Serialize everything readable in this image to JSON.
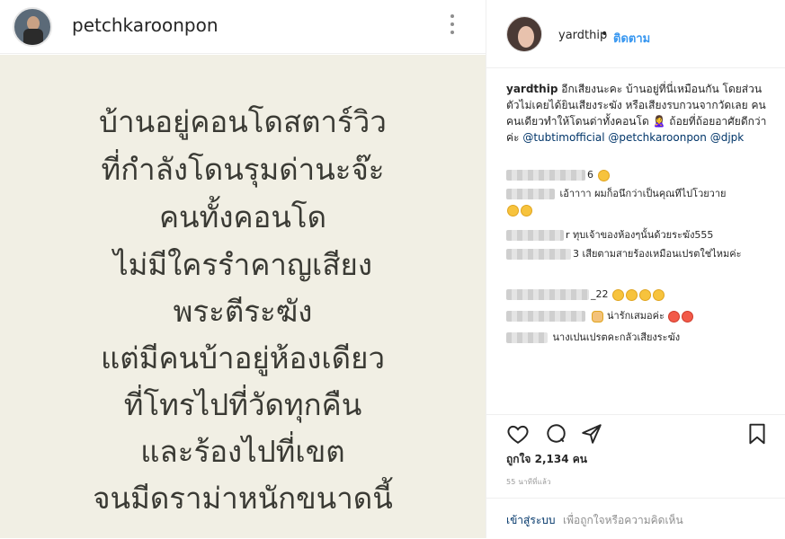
{
  "post": {
    "author": "petchkaroonpon",
    "note_lines": [
      "บ้านอยู่คอนโดสตาร์วิว",
      "ที่กำลังโดนรุมด่านะจ๊ะ",
      "คนทั้งคอนโด",
      "ไม่มีใครรำคาญเสียง",
      "พระตีระฆัง",
      "แต่มีคนบ้าอยู่ห้องเดียว",
      "ที่โทรไปที่วัดทุกคืน",
      "และร้องไปที่เขต",
      "จนมีดราม่าหนักขนาดนี้"
    ],
    "note_background": "#f1efe4",
    "note_text_color": "#3a3a34"
  },
  "panel": {
    "username": "yardthip",
    "separator": "•",
    "follow_label": "ติดตาม",
    "accent_color": "#3897f0"
  },
  "caption": {
    "username": "yardthip",
    "text": "อีกเสียงนะคะ บ้านอยู่ที่นี่เหมือนกัน โดยส่วนตัวไม่เคยได้ยินเสียงระฆัง หรือเสียงรบกวนจากวัดเลย คนคนเดียวทำให้โดนด่าทั้งคอนโด 🙎‍♀️ ถ้อยที่ถ้อยอาศัยดีกว่าค่ะ",
    "mention1": "@tubtimofficial",
    "mention2": "@petchkaroonpon",
    "mention3": "@djpk"
  },
  "comments": [
    {
      "suffix": "6",
      "text": ""
    },
    {
      "suffix": "",
      "text": "เอ้าาาา ผมก็อนึกว่าเป็นคุณทีไปโวยวาย"
    },
    {
      "suffix": "r",
      "text": "ทุบเจ้าของห้องๆนั้นด้วยระฆัง555"
    },
    {
      "suffix": "3",
      "text": "เสียตามสายร้องเหมือนเปรตใช่ไหมค่ะ"
    },
    {
      "suffix": "_22",
      "text": ""
    },
    {
      "suffix": "",
      "text": "น่ารักเสมอค่ะ"
    },
    {
      "suffix": "",
      "text": "นางเปนเปรตคะกลัวเสียงระฆัง"
    }
  ],
  "actions": {
    "likes": "ถูกใจ 2,134 คน",
    "time": "55 นาทีที่แล้ว",
    "login_label": "เข้าสู่ระบบ",
    "comment_prompt": "เพื่อถูกใจหรือความคิดเห็น"
  },
  "icons": [
    "more-icon",
    "heart-icon",
    "comment-icon",
    "share-icon",
    "save-icon"
  ]
}
